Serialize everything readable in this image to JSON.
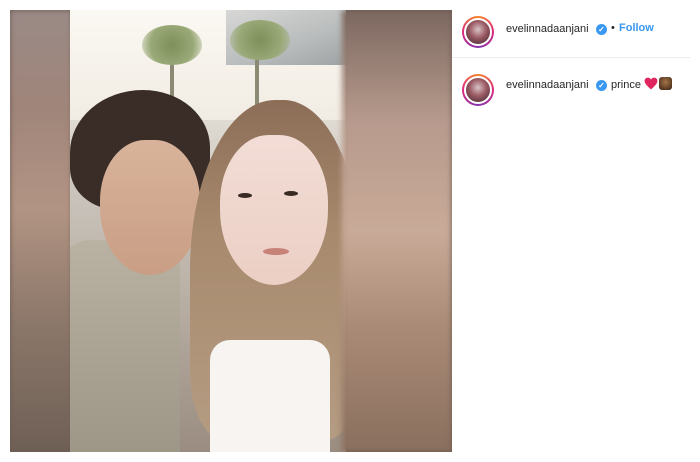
{
  "post": {
    "username": "evelinnadaanjani",
    "verified_icon": "verified-badge-icon",
    "separator": "•",
    "follow_label": "Follow"
  },
  "comment": {
    "username": "evelinnadaanjani",
    "text": "prince",
    "emoji_icons": [
      "red-heart-icon",
      "prince-emoji-icon"
    ]
  },
  "colors": {
    "accent": "#3897f0",
    "text": "#262626",
    "heart": "#e0245e"
  }
}
